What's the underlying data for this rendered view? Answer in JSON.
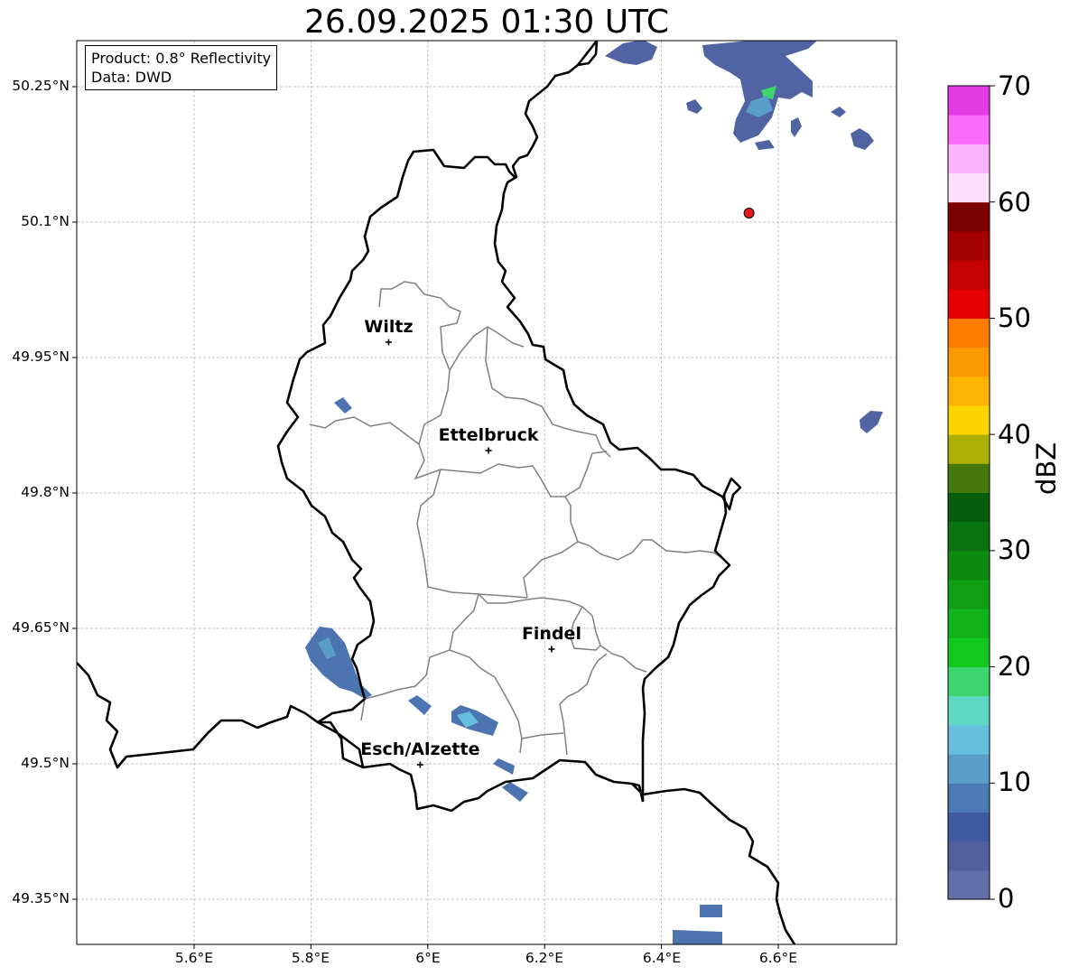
{
  "title": "26.09.2025 01:30 UTC",
  "info": {
    "product": "Product: 0.8° Reflectivity",
    "source": "Data: DWD"
  },
  "axes": {
    "lat_labels": [
      "50.25°N",
      "50.1°N",
      "49.95°N",
      "49.8°N",
      "49.65°N",
      "49.5°N",
      "49.35°N"
    ],
    "lon_labels": [
      "5.6°E",
      "5.8°E",
      "6°E",
      "6.2°E",
      "6.4°E",
      "6.6°E"
    ]
  },
  "cities": [
    {
      "name": "Wiltz",
      "lat": 49.967,
      "lon": 5.933
    },
    {
      "name": "Ettelbruck",
      "lat": 49.847,
      "lon": 6.104
    },
    {
      "name": "Findel",
      "lat": 49.627,
      "lon": 6.212
    },
    {
      "name": "Esch/Alzette",
      "lat": 49.499,
      "lon": 5.987
    }
  ],
  "radar_site": {
    "lat": 50.11,
    "lon": 6.55,
    "color": "#e41a1c"
  },
  "colorbar": {
    "unit": "dBZ",
    "tick_labels": [
      "0",
      "10",
      "20",
      "30",
      "40",
      "50",
      "60",
      "70"
    ],
    "colors": [
      "#6070a8",
      "#50609c",
      "#405aa0",
      "#4c7ab4",
      "#5a9ec8",
      "#64c0dc",
      "#5ed8c4",
      "#3cd66c",
      "#10c81e",
      "#10b41a",
      "#109e14",
      "#0c8a10",
      "#0a7410",
      "#065e0c",
      "#447a0c",
      "#acb004",
      "#fcd400",
      "#fcb400",
      "#fc9800",
      "#fc7c00",
      "#e40000",
      "#c40000",
      "#a40000",
      "#7c0000",
      "#fce0fc",
      "#fcb4fc",
      "#fc6cfc",
      "#e43ce4"
    ]
  }
}
